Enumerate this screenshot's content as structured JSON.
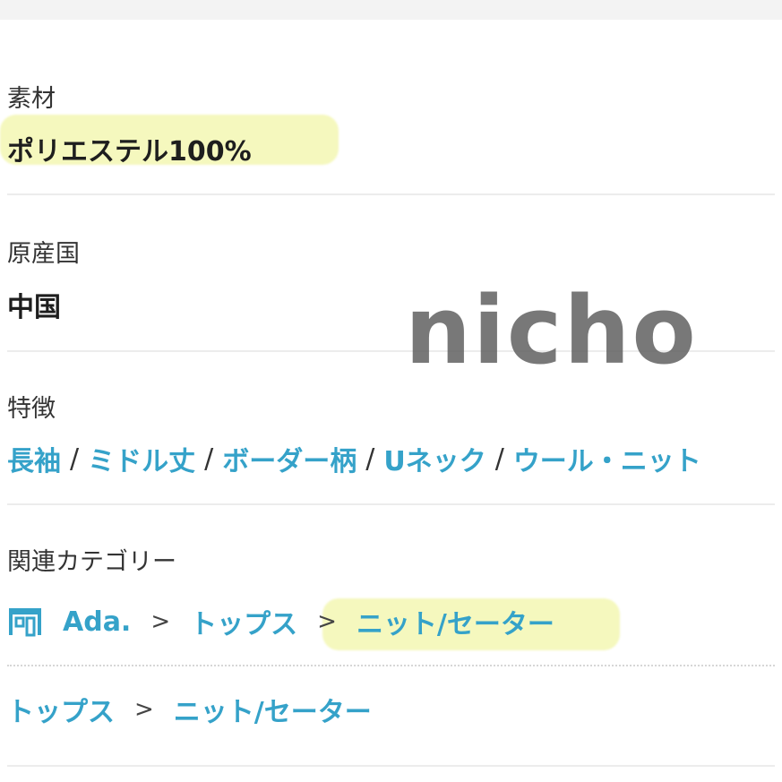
{
  "material": {
    "label": "素材",
    "value": "ポリエステル100%"
  },
  "origin": {
    "label": "原産国",
    "value": "中国"
  },
  "features": {
    "label": "特徴",
    "separator": "/",
    "tags": [
      "長袖",
      "ミドル丈",
      "ボーダー柄",
      "Uネック",
      "ウール・ニット"
    ]
  },
  "related_categories": {
    "label": "関連カテゴリー",
    "shop_path": {
      "shop": "Ada.",
      "separator": ">",
      "items": [
        "トップス",
        "ニット/セーター"
      ]
    },
    "general_path": {
      "separator": ">",
      "items": [
        "トップス",
        "ニット/セーター"
      ]
    }
  },
  "watermark": "nicho",
  "colors": {
    "link": "#35a2c9",
    "highlight": "#e8f06e",
    "text": "#222222"
  },
  "icons": {
    "shop": "shop-icon"
  }
}
